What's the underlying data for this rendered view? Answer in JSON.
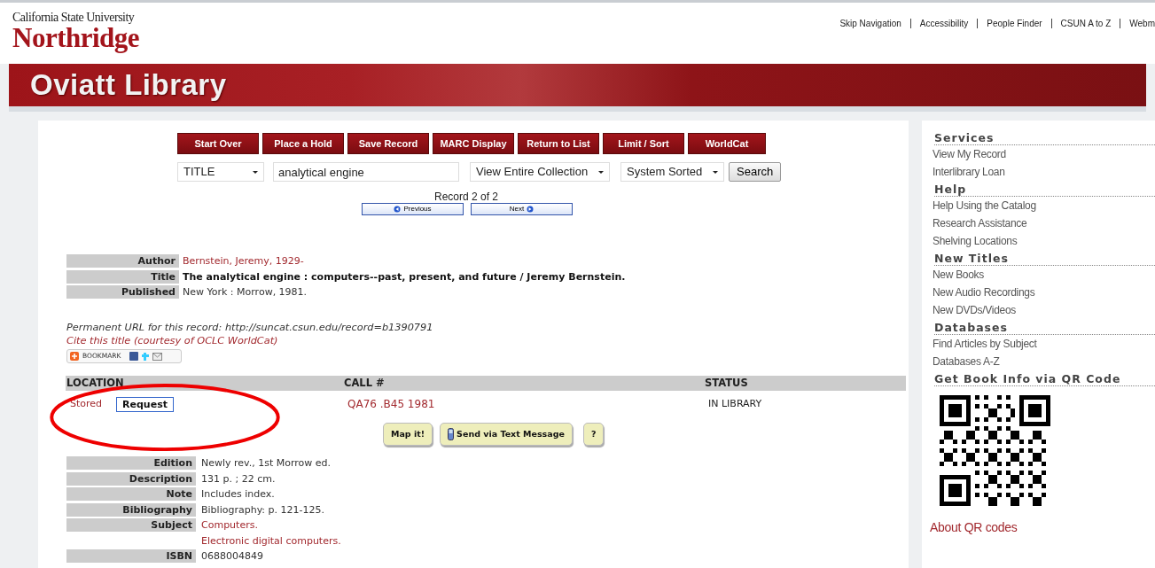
{
  "header": {
    "university": "California State University",
    "campus": "Northridge",
    "top_links": [
      "Skip Navigation",
      "Accessibility",
      "People Finder",
      "CSUN A to Z",
      "Webm"
    ]
  },
  "banner": {
    "title": "Oviatt Library"
  },
  "actions": [
    "Start Over",
    "Place a Hold",
    "Save Record",
    "MARC Display",
    "Return to List",
    "Limit / Sort",
    "WorldCat"
  ],
  "search": {
    "index": "TITLE",
    "query": "analytical engine",
    "scope": "View Entire Collection",
    "sort": "System Sorted",
    "button": "Search"
  },
  "record_nav": {
    "position": "Record 2 of 2",
    "previous": "Previous",
    "next": "Next"
  },
  "bib_fields": [
    {
      "label": "Author",
      "value": "Bernstein, Jeremy, 1929-",
      "kind": "link"
    },
    {
      "label": "Title",
      "value": "The analytical engine : computers--past, present, and future / Jeremy Bernstein.",
      "kind": "bold"
    },
    {
      "label": "Published",
      "value": "New York : Morrow, 1981.",
      "kind": "plain"
    }
  ],
  "permanent_url": "Permanent URL for this record: http://suncat.csun.edu/record=b1390791",
  "cite_link": "Cite this title (courtesy of OCLC WorldCat)",
  "bookmark": {
    "label": "BOOKMARK"
  },
  "holdings": {
    "columns": [
      "LOCATION",
      "CALL #",
      "STATUS"
    ],
    "rows": [
      {
        "location": "Stored",
        "request": "Request",
        "call_number": "QA76 .B45 1981",
        "status": "IN LIBRARY"
      }
    ]
  },
  "holding_actions": [
    {
      "label": "Map it!",
      "kind": "plain"
    },
    {
      "label": "Send via Text Message",
      "kind": "phone"
    },
    {
      "label": "?",
      "kind": "plain"
    }
  ],
  "details": [
    {
      "label": "Edition",
      "values": [
        {
          "text": "Newly rev., 1st Morrow ed.",
          "kind": "plain"
        }
      ]
    },
    {
      "label": "Description",
      "values": [
        {
          "text": "131 p. ; 22 cm.",
          "kind": "plain"
        }
      ]
    },
    {
      "label": "Note",
      "values": [
        {
          "text": "Includes index.",
          "kind": "plain"
        }
      ]
    },
    {
      "label": "Bibliography",
      "values": [
        {
          "text": "Bibliography: p. 121-125.",
          "kind": "plain"
        }
      ]
    },
    {
      "label": "Subject",
      "values": [
        {
          "text": "Computers.",
          "kind": "link"
        },
        {
          "text": "Electronic digital computers.",
          "kind": "link"
        }
      ]
    },
    {
      "label": "ISBN",
      "values": [
        {
          "text": "0688004849",
          "kind": "plain"
        }
      ]
    }
  ],
  "sidebar": {
    "sections": [
      {
        "title": "Services",
        "links": [
          "View My Record",
          "Interlibrary Loan"
        ]
      },
      {
        "title": "Help",
        "links": [
          "Help Using the Catalog",
          "Research Assistance",
          "Shelving Locations"
        ]
      },
      {
        "title": "New Titles",
        "links": [
          "New Books",
          "New Audio Recordings",
          "New DVDs/Videos"
        ]
      },
      {
        "title": "Databases",
        "links": [
          "Find Articles by Subject",
          "Databases A-Z"
        ]
      }
    ],
    "qr": {
      "title": "Get Book Info via QR Code",
      "link": "About QR codes"
    }
  }
}
